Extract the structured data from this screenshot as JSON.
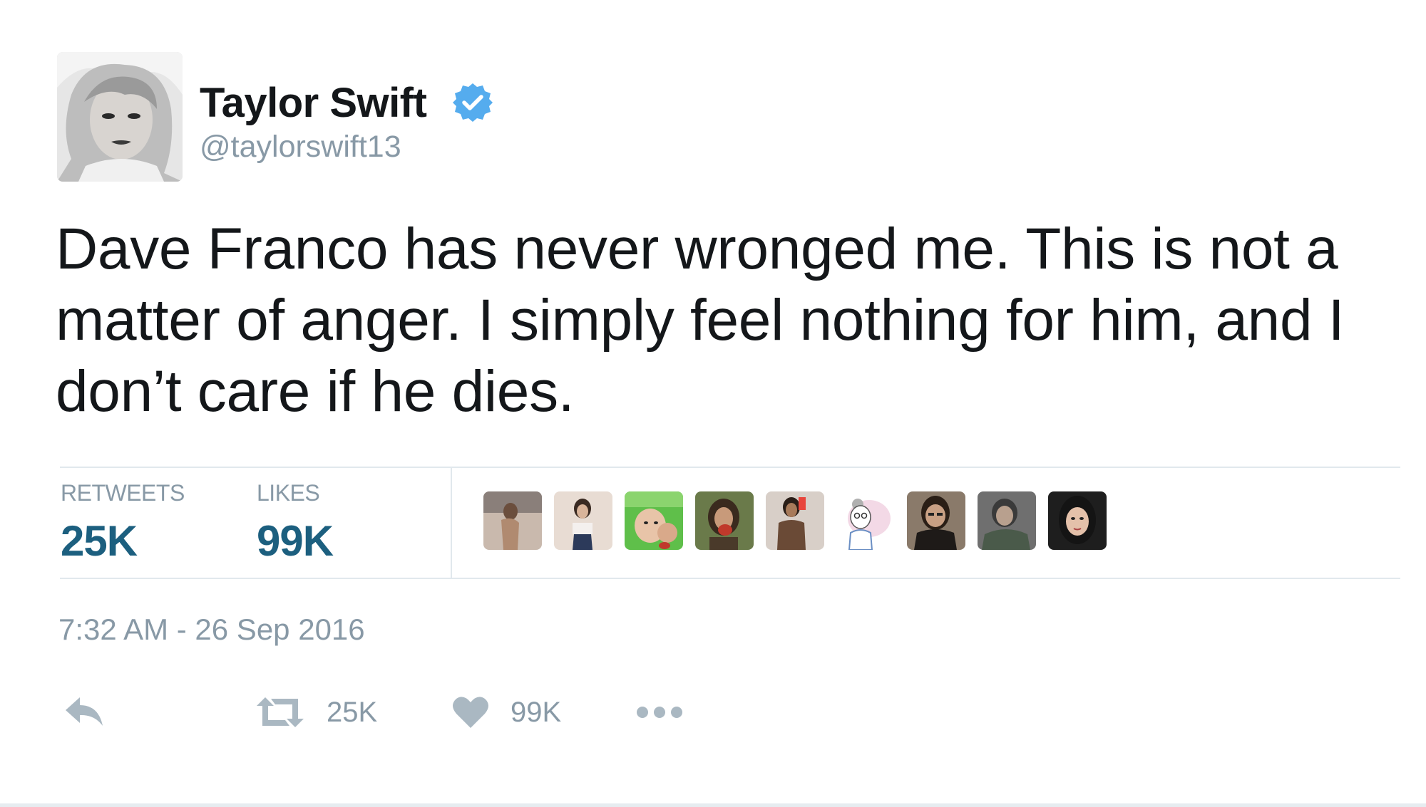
{
  "tweet": {
    "author": {
      "display_name": "Taylor Swift",
      "handle": "@taylorswift13",
      "verified": true
    },
    "text_lines": [
      "Dave Franco has never wronged me. This is not a",
      "matter of anger. I simply feel nothing for him, and I",
      "don’t care if he dies."
    ],
    "stats": {
      "retweets_label": "RETWEETS",
      "retweets_value": "25K",
      "likes_label": "LIKES",
      "likes_value": "99K"
    },
    "likers_count_shown": 9,
    "timestamp": "7:32 AM - 26 Sep 2016",
    "actions": {
      "reply_icon": "reply-icon",
      "retweet_icon": "retweet-icon",
      "retweet_count": "25K",
      "like_icon": "heart-icon",
      "like_count": "99K",
      "more_icon": "more-dots-icon"
    }
  },
  "colors": {
    "verified_blue": "#55acee",
    "stat_value": "#1c5f7f",
    "muted_gray": "#8899a6",
    "action_gray": "#aab8c2",
    "divider": "#e1e8ed",
    "text": "#14171a"
  }
}
